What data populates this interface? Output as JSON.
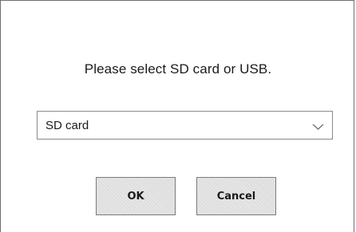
{
  "dialog": {
    "prompt": "Please select SD card or USB.",
    "storage_select": {
      "selected": "SD card",
      "icon": "chevron-down-icon"
    },
    "buttons": {
      "ok_label": "OK",
      "cancel_label": "Cancel"
    }
  }
}
